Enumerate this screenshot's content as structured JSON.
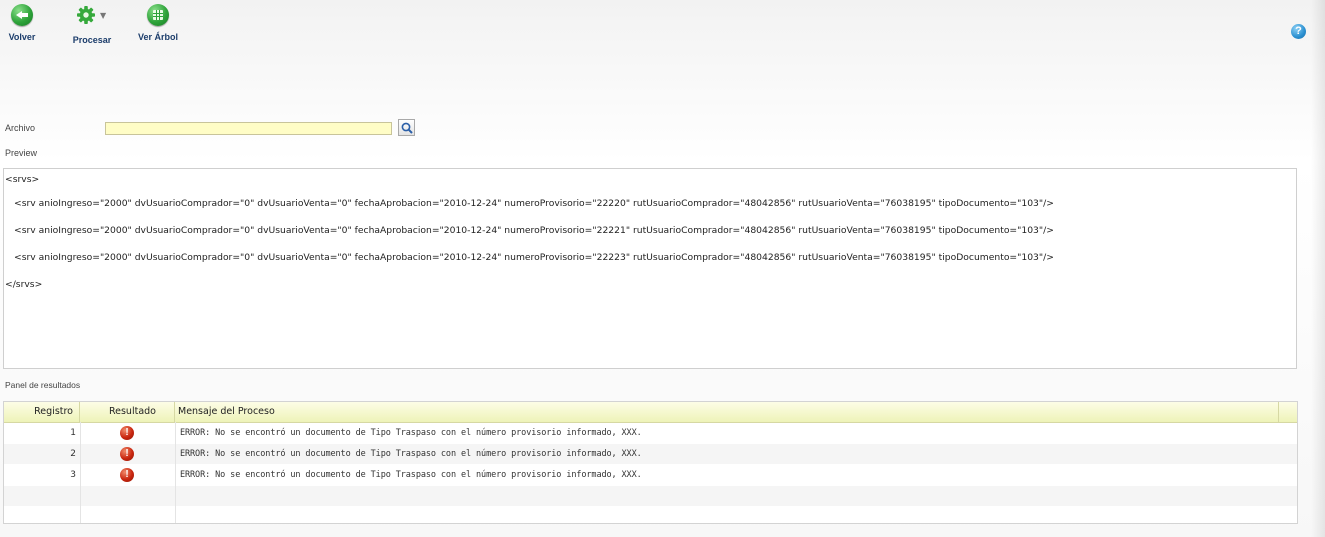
{
  "toolbar": {
    "volver": "Volver",
    "procesar": "Procesar",
    "ver_arbol": "Ver Árbol",
    "help_glyph": "?"
  },
  "form": {
    "archivo_label": "Archivo",
    "archivo_value": "",
    "preview_label": "Preview"
  },
  "preview": {
    "lines": [
      "<srvs>",
      "<srv anioIngreso=\"2000\" dvUsuarioComprador=\"0\" dvUsuarioVenta=\"0\" fechaAprobacion=\"2010-12-24\" numeroProvisorio=\"22220\" rutUsuarioComprador=\"48042856\" rutUsuarioVenta=\"76038195\" tipoDocumento=\"103\"/>",
      "<srv anioIngreso=\"2000\" dvUsuarioComprador=\"0\" dvUsuarioVenta=\"0\" fechaAprobacion=\"2010-12-24\" numeroProvisorio=\"22221\" rutUsuarioComprador=\"48042856\" rutUsuarioVenta=\"76038195\" tipoDocumento=\"103\"/>",
      "<srv anioIngreso=\"2000\" dvUsuarioComprador=\"0\" dvUsuarioVenta=\"0\" fechaAprobacion=\"2010-12-24\" numeroProvisorio=\"22223\" rutUsuarioComprador=\"48042856\" rutUsuarioVenta=\"76038195\" tipoDocumento=\"103\"/>",
      "</srvs>"
    ]
  },
  "results": {
    "panel_label": "Panel de resultados",
    "headers": [
      "Registro",
      "Resultado",
      "Mensaje del Proceso"
    ],
    "rows": [
      {
        "registro": "1",
        "resultado_icon": "error-icon",
        "mensaje": "ERROR: No se encontró un documento de Tipo Traspaso con el número provisorio informado, XXX."
      },
      {
        "registro": "2",
        "resultado_icon": "error-icon",
        "mensaje": "ERROR: No se encontró un documento de Tipo Traspaso con el número provisorio informado, XXX."
      },
      {
        "registro": "3",
        "resultado_icon": "error-icon",
        "mensaje": "ERROR: No se encontró un documento de Tipo Traspaso con el número provisorio informado, XXX."
      }
    ],
    "error_glyph": "!"
  },
  "colors": {
    "toolbar_icon_green": "#2ea33a",
    "input_bg": "#fffdc6",
    "grid_header": "#eef3b8",
    "error_red": "#c9260f",
    "help_blue": "#2a8fd0"
  }
}
